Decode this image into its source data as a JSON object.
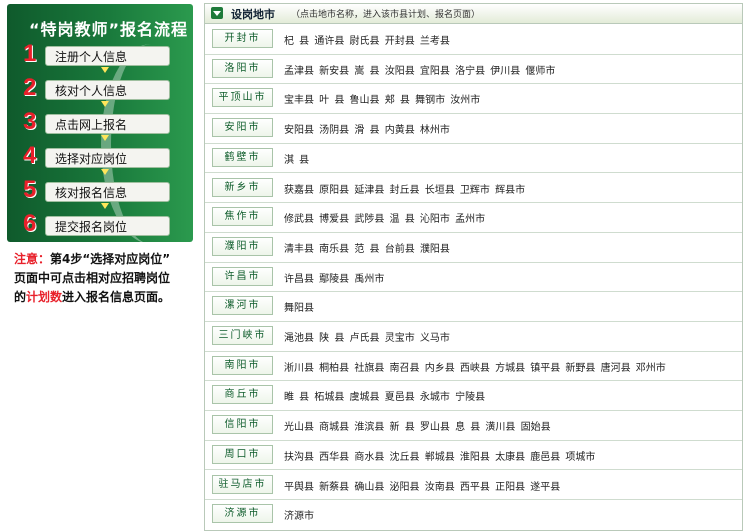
{
  "flow": {
    "title": "“特岗教师”报名流程",
    "steps": [
      {
        "num": "1",
        "label": "注册个人信息"
      },
      {
        "num": "2",
        "label": "核对个人信息"
      },
      {
        "num": "3",
        "label": "点击网上报名"
      },
      {
        "num": "4",
        "label": "选择对应岗位"
      },
      {
        "num": "5",
        "label": "核对报名信息"
      },
      {
        "num": "6",
        "label": "提交报名岗位"
      }
    ]
  },
  "note": {
    "prefix": "注意：",
    "line1": "第4步“选择对应岗位”",
    "line2": "页面中可点击相对应招聘岗位",
    "line3_pre": "的",
    "line3_red": "计划数",
    "line3_post": "进入报名信息页面。"
  },
  "table": {
    "title": "设岗地市",
    "hint": "（点击地市名称，进入该市县计划、报名页面）",
    "rows": [
      {
        "city": "开封市",
        "counties": "杞 县  通许县  尉氏县  开封县  兰考县"
      },
      {
        "city": "洛阳市",
        "counties": "孟津县  新安县  嵩 县  汝阳县  宜阳县  洛宁县  伊川县  偃师市"
      },
      {
        "city": "平顶山市",
        "counties": "宝丰县  叶 县  鲁山县  郏 县  舞钢市  汝州市"
      },
      {
        "city": "安阳市",
        "counties": "安阳县  汤阴县  滑 县  内黄县  林州市"
      },
      {
        "city": "鹤壁市",
        "counties": "淇 县"
      },
      {
        "city": "新乡市",
        "counties": "获嘉县  原阳县  延津县  封丘县  长垣县  卫辉市  辉县市"
      },
      {
        "city": "焦作市",
        "counties": "修武县  博爱县  武陟县  温 县  沁阳市  孟州市"
      },
      {
        "city": "濮阳市",
        "counties": "清丰县  南乐县  范 县  台前县  濮阳县"
      },
      {
        "city": "许昌市",
        "counties": "许昌县  鄢陵县  禹州市"
      },
      {
        "city": "漯河市",
        "counties": "舞阳县"
      },
      {
        "city": "三门峡市",
        "counties": "渑池县  陕 县  卢氏县  灵宝市  义马市"
      },
      {
        "city": "南阳市",
        "counties": "淅川县  桐柏县  社旗县  南召县  内乡县  西峡县  方城县  镇平县  新野县  唐河县  邓州市"
      },
      {
        "city": "商丘市",
        "counties": "睢 县  柘城县  虞城县  夏邑县  永城市  宁陵县"
      },
      {
        "city": "信阳市",
        "counties": "光山县  商城县  淮滨县  新 县  罗山县  息 县  潢川县  固始县"
      },
      {
        "city": "周口市",
        "counties": "扶沟县  西华县  商水县  沈丘县  郸城县  淮阳县  太康县  鹿邑县  项城市"
      },
      {
        "city": "驻马店市",
        "counties": "平舆县  新蔡县  确山县  泌阳县  汝南县  西平县  正阳县  遂平县"
      },
      {
        "city": "济源市",
        "counties": "济源市"
      }
    ]
  }
}
